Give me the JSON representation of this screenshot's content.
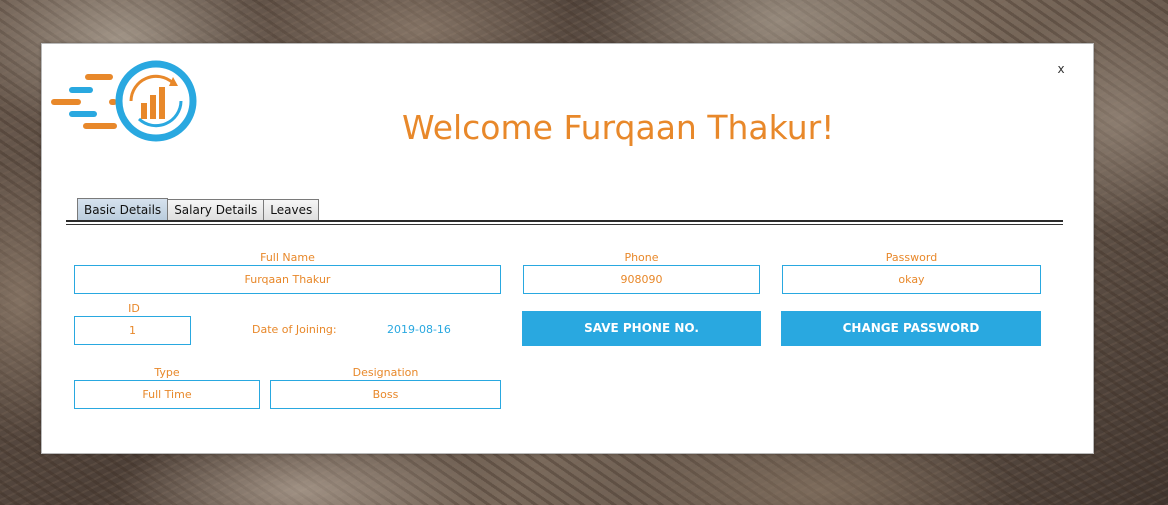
{
  "window": {
    "close_label": "x",
    "welcome_text": "Welcome Furqaan Thakur!"
  },
  "tabs": [
    {
      "label": "Basic Details",
      "active": true
    },
    {
      "label": "Salary Details",
      "active": false
    },
    {
      "label": "Leaves",
      "active": false
    }
  ],
  "form": {
    "full_name": {
      "label": "Full Name",
      "value": "Furqaan Thakur"
    },
    "phone": {
      "label": "Phone",
      "value": "908090"
    },
    "password": {
      "label": "Password",
      "value": "okay"
    },
    "id": {
      "label": "ID",
      "value": "1"
    },
    "date_of_joining": {
      "label": "Date of Joining:",
      "value": "2019-08-16"
    },
    "type": {
      "label": "Type",
      "value": "Full Time"
    },
    "designation": {
      "label": "Designation",
      "value": "Boss"
    }
  },
  "buttons": {
    "save_phone": "SAVE PHONE NO.",
    "change_password": "CHANGE PASSWORD"
  },
  "colors": {
    "accent_orange": "#e8882a",
    "accent_blue": "#29a8e0"
  },
  "logo": {
    "icon": "analytics-chart-logo-icon"
  }
}
